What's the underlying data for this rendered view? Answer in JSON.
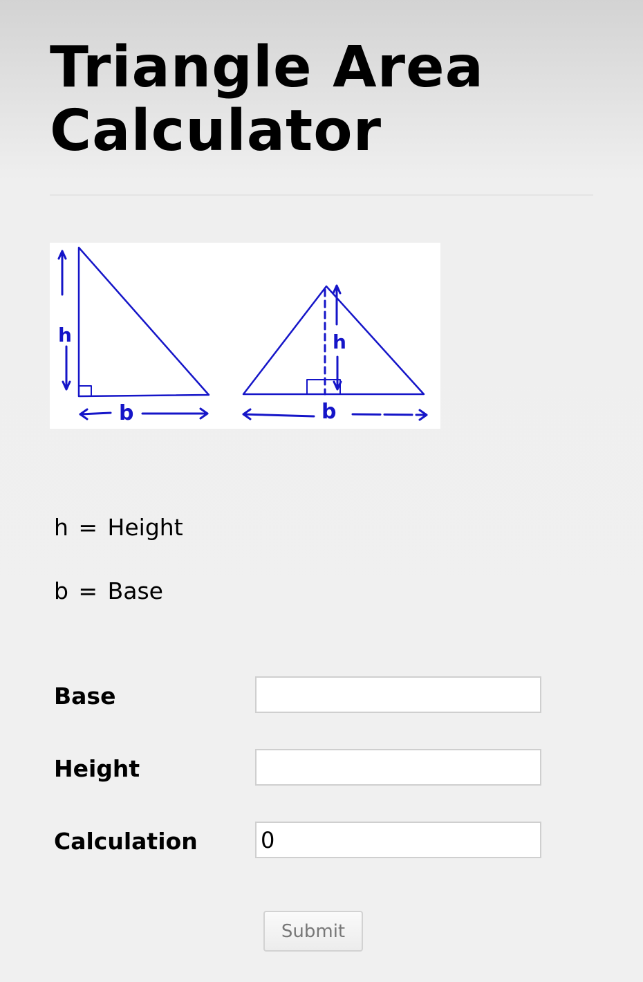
{
  "page": {
    "title": "Triangle Area Calculator"
  },
  "figure": {
    "height_symbol": "h",
    "base_symbol": "b",
    "line_color": "#1515c8"
  },
  "legend": {
    "height": "h = Height",
    "base": "b = Base"
  },
  "form": {
    "base_label": "Base",
    "base_value": "",
    "height_label": "Height",
    "height_value": "",
    "calculation_label": "Calculation",
    "calculation_value": "0",
    "submit_label": "Submit"
  }
}
